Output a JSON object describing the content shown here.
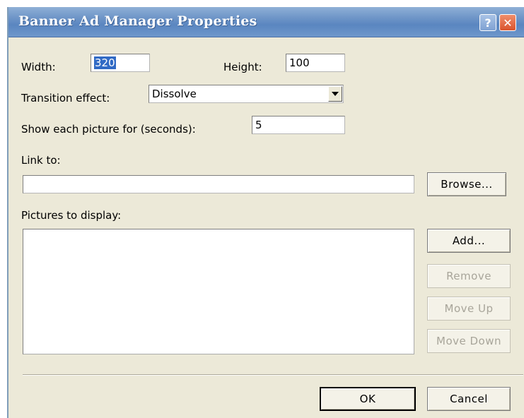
{
  "window": {
    "title": "Banner Ad Manager Properties",
    "help_icon": "question-mark-icon",
    "close_icon": "close-x-icon"
  },
  "form": {
    "width_label": "Width:",
    "width_value": "320",
    "height_label": "Height:",
    "height_value": "100",
    "transition_label": "Transition effect:",
    "transition_value": "Dissolve",
    "show_label": "Show each picture for (seconds):",
    "show_value": "5",
    "link_label": "Link to:",
    "link_value": "",
    "browse_label": "Browse...",
    "pictures_label": "Pictures to display:",
    "pictures": []
  },
  "side_buttons": {
    "add": "Add...",
    "remove": "Remove",
    "move_up": "Move Up",
    "move_down": "Move Down"
  },
  "footer": {
    "ok": "OK",
    "cancel": "Cancel"
  },
  "colors": {
    "titlebar": "#6f96c8",
    "dialog_bg": "#ece9d8",
    "selection": "#316ac5",
    "disabled_text": "#a8a59a"
  }
}
